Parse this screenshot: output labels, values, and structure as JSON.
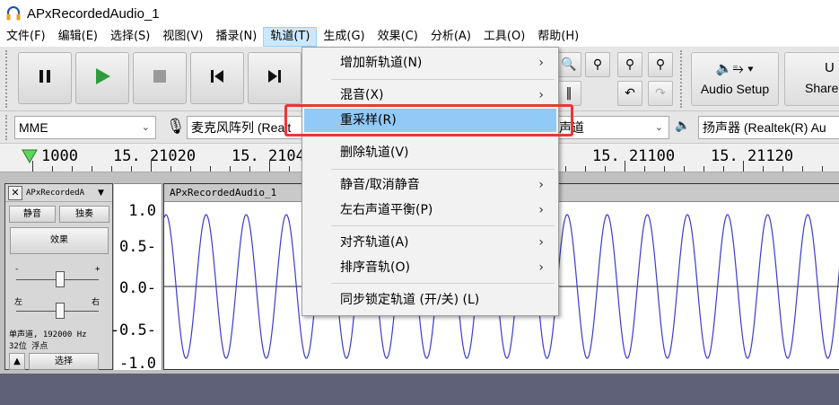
{
  "window": {
    "title": "APxRecordedAudio_1",
    "icon": "headphones-icon"
  },
  "menubar": {
    "items": [
      {
        "label": "文件(F)"
      },
      {
        "label": "编辑(E)"
      },
      {
        "label": "选择(S)"
      },
      {
        "label": "视图(V)"
      },
      {
        "label": "播录(N)"
      },
      {
        "label": "轨道(T)"
      },
      {
        "label": "生成(G)"
      },
      {
        "label": "效果(C)"
      },
      {
        "label": "分析(A)"
      },
      {
        "label": "工具(O)"
      },
      {
        "label": "帮助(H)"
      }
    ],
    "active_index": 5
  },
  "toolbar": {
    "audio_setup_label": "Audio Setup",
    "share_label": "Share"
  },
  "devices": {
    "host": "MME",
    "mic": "麦克风阵列 (Realt",
    "channels": "声道",
    "speaker": "扬声器 (Realtek(R) Au"
  },
  "ruler": {
    "labels": [
      "1000",
      "15. 21020",
      "15. 2104",
      "15. 21100",
      "15. 21120"
    ]
  },
  "track": {
    "name": "APxRecordedA",
    "mute_label": "静音",
    "solo_label": "独奏",
    "effect_label": "效果",
    "gain_minus": "-",
    "gain_plus": "+",
    "pan_left": "左",
    "pan_right": "右",
    "info_line1": "单声道, 192000 Hz",
    "info_line2": "32位 浮点",
    "select_label": "选择",
    "clip_name": "APxRecordedAudio_1",
    "scale": [
      "1.0",
      "0.5-",
      "0.0-",
      "-0.5-",
      "-1.0"
    ]
  },
  "dropdown_menu": {
    "items": [
      {
        "label": "增加新轨道(N)",
        "submenu": true
      },
      {
        "label": "混音(X)",
        "submenu": true
      },
      {
        "label": "重采样(R)",
        "submenu": false,
        "highlighted": true
      },
      {
        "label": "删除轨道(V)",
        "submenu": false
      },
      {
        "label": "静音/取消静音",
        "submenu": true
      },
      {
        "label": "左右声道平衡(P)",
        "submenu": true
      },
      {
        "label": "对齐轨道(A)",
        "submenu": true
      },
      {
        "label": "排序音轨(O)",
        "submenu": true
      },
      {
        "label": "同步锁定轨道 (开/关) (L)",
        "submenu": false
      }
    ]
  },
  "colors": {
    "accent": "#91c9f7",
    "waveform": "#3a3ccc",
    "annotation": "#e53935",
    "play": "#2e9b3e"
  }
}
